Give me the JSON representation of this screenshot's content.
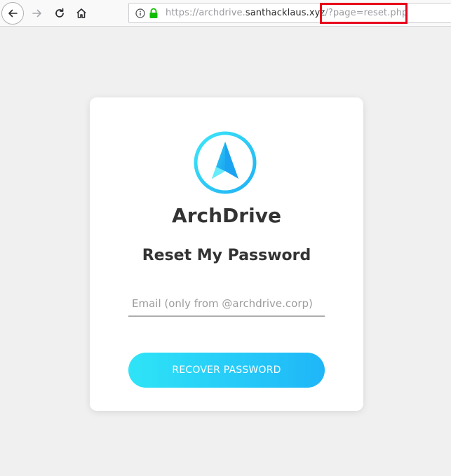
{
  "browser": {
    "url_scheme_host_prefix": "https://archdrive.",
    "url_domain": "santhacklaus.xyz",
    "url_query": "/?page=reset.php"
  },
  "icons": {
    "back": "back-arrow-icon",
    "forward": "forward-arrow-icon",
    "reload": "reload-icon",
    "home": "home-icon",
    "info": "info-icon",
    "lock": "lock-icon",
    "logo": "compass-arrow-logo-icon"
  },
  "colors": {
    "accent_start": "#2fe4f7",
    "accent_end": "#1fb6f8",
    "highlight_box": "#e8001a",
    "lock": "#12bc00"
  },
  "card": {
    "brand": "ArchDrive",
    "heading": "Reset My Password",
    "email_placeholder": "Email (only from @archdrive.corp)",
    "email_value": "",
    "button_label": "RECOVER PASSWORD"
  }
}
